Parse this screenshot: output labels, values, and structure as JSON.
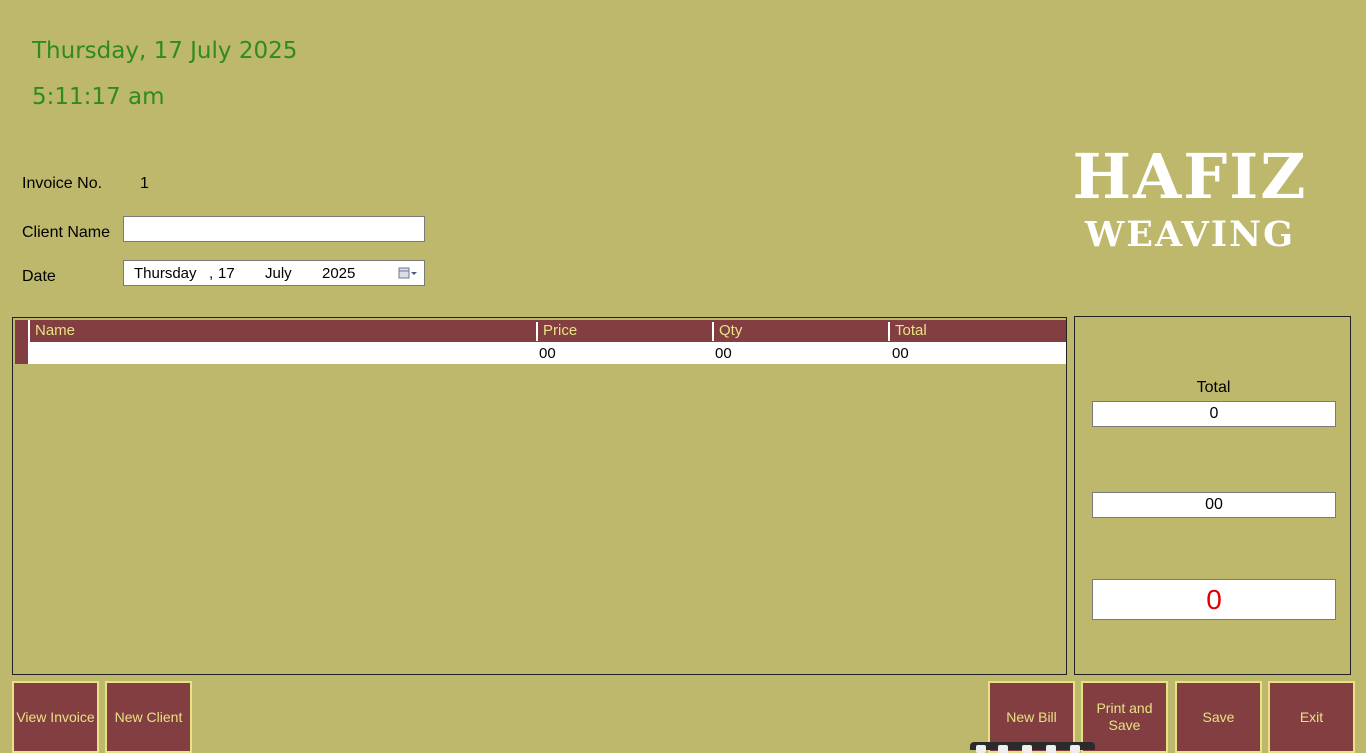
{
  "header": {
    "date_text": "Thursday, 17 July 2025",
    "time_text": "5:11:17 am"
  },
  "invoice": {
    "invoice_no_label": "Invoice No.",
    "invoice_no_value": "1",
    "client_name_label": "Client Name",
    "client_name_value": "",
    "date_label": "Date",
    "date_picker": {
      "weekday": "Thursday",
      "sep": ",",
      "day": "17",
      "month": "July",
      "year": "2025",
      "icon": "calendar-dropdown-icon"
    }
  },
  "logo": {
    "line1": "HAFIZ",
    "line2": "WEAVING"
  },
  "grid": {
    "columns": [
      "Name",
      "Price",
      "Qty",
      "Total"
    ],
    "rows": [
      {
        "name": "",
        "price": "00",
        "qty": "00",
        "total": "00"
      }
    ]
  },
  "totals": {
    "title": "Total",
    "total_value": "0",
    "second_value": "00",
    "grand_value": "0"
  },
  "buttons": {
    "view_invoice": "View Invoice",
    "new_client": "New Client",
    "new_bill": "New Bill",
    "print_and_save": "Print and Save",
    "save": "Save",
    "exit": "Exit"
  },
  "colors": {
    "background": "#bdb86c",
    "accent": "#823e41",
    "button_text": "#e9e186",
    "clock_text": "#2f8a1f",
    "grand_total_text": "#e00000"
  }
}
